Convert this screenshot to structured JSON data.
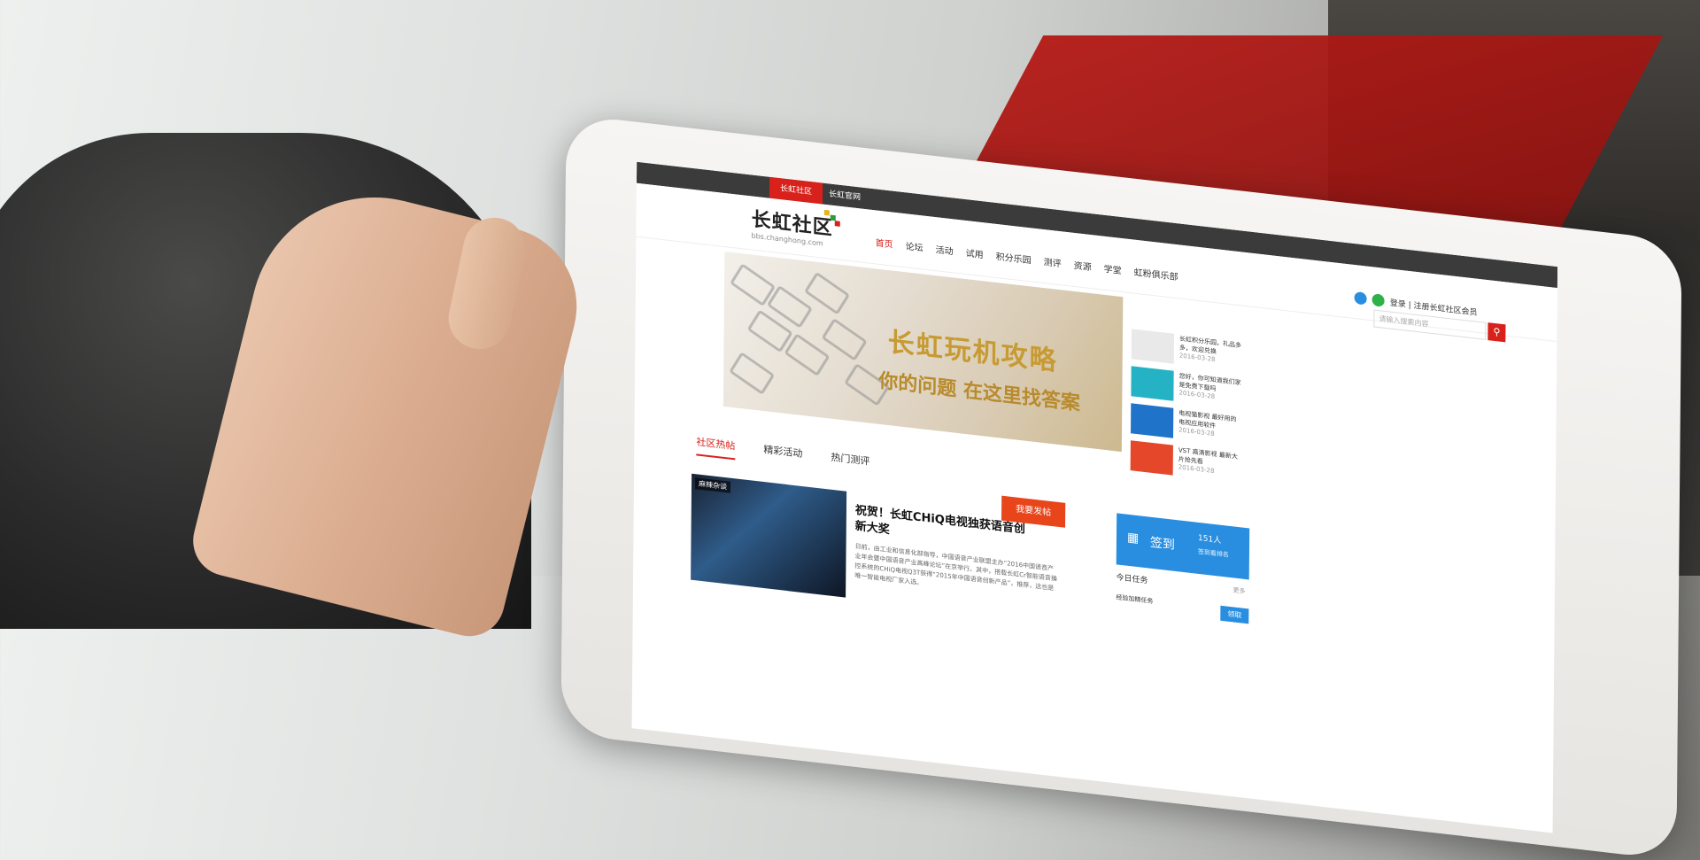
{
  "topbar": {
    "tab_community": "长虹社区",
    "tab_official": "长虹官网"
  },
  "logo": {
    "name": "长虹社区",
    "url": "bbs.changhong.com"
  },
  "nav": [
    "首页",
    "论坛",
    "活动",
    "试用",
    "积分乐园",
    "测评",
    "资源",
    "学堂",
    "虹粉俱乐部"
  ],
  "user": {
    "links": "登录 | 注册长虹社区会员"
  },
  "search": {
    "placeholder": "请输入搜索内容"
  },
  "banner": {
    "headline": "长虹玩机攻略",
    "subline": "你的问题 在这里找答案"
  },
  "side_news": [
    {
      "text": "长虹积分乐园，礼品多多，欢迎兑换",
      "date": "2016-03-28"
    },
    {
      "text": "您好，你可知道我们家是免费下载吗",
      "date": "2016-03-28"
    },
    {
      "text": "电视猫影视 最好用的电视应用软件",
      "date": "2016-03-28"
    },
    {
      "text": "VST 高清影视 最新大片抢先看",
      "date": "2016-03-28"
    }
  ],
  "tabs": [
    "社区热帖",
    "精彩活动",
    "热门测评"
  ],
  "post_button": "我要发帖",
  "post": {
    "tag": "麻辣杂谈",
    "title": "祝贺！长虹CHiQ电视独获语音创新大奖",
    "body": "日前，由工业和信息化部指导，中国语音产业联盟主办“2016中国语音产业年会暨中国语音产业高峰论坛”在京举行。其中，搭载长虹Cr智能语音操控系统的CHiQ电视Q3T获得“2015年中国语音创新产品”，推荐，这也是唯一智能电视厂家入选。"
  },
  "signin": {
    "label": "签到",
    "count": "151人",
    "rank": "签到看排名"
  },
  "task": {
    "title": "今日任务",
    "more": "更多",
    "row": "经验加精任务",
    "button": "领取"
  }
}
